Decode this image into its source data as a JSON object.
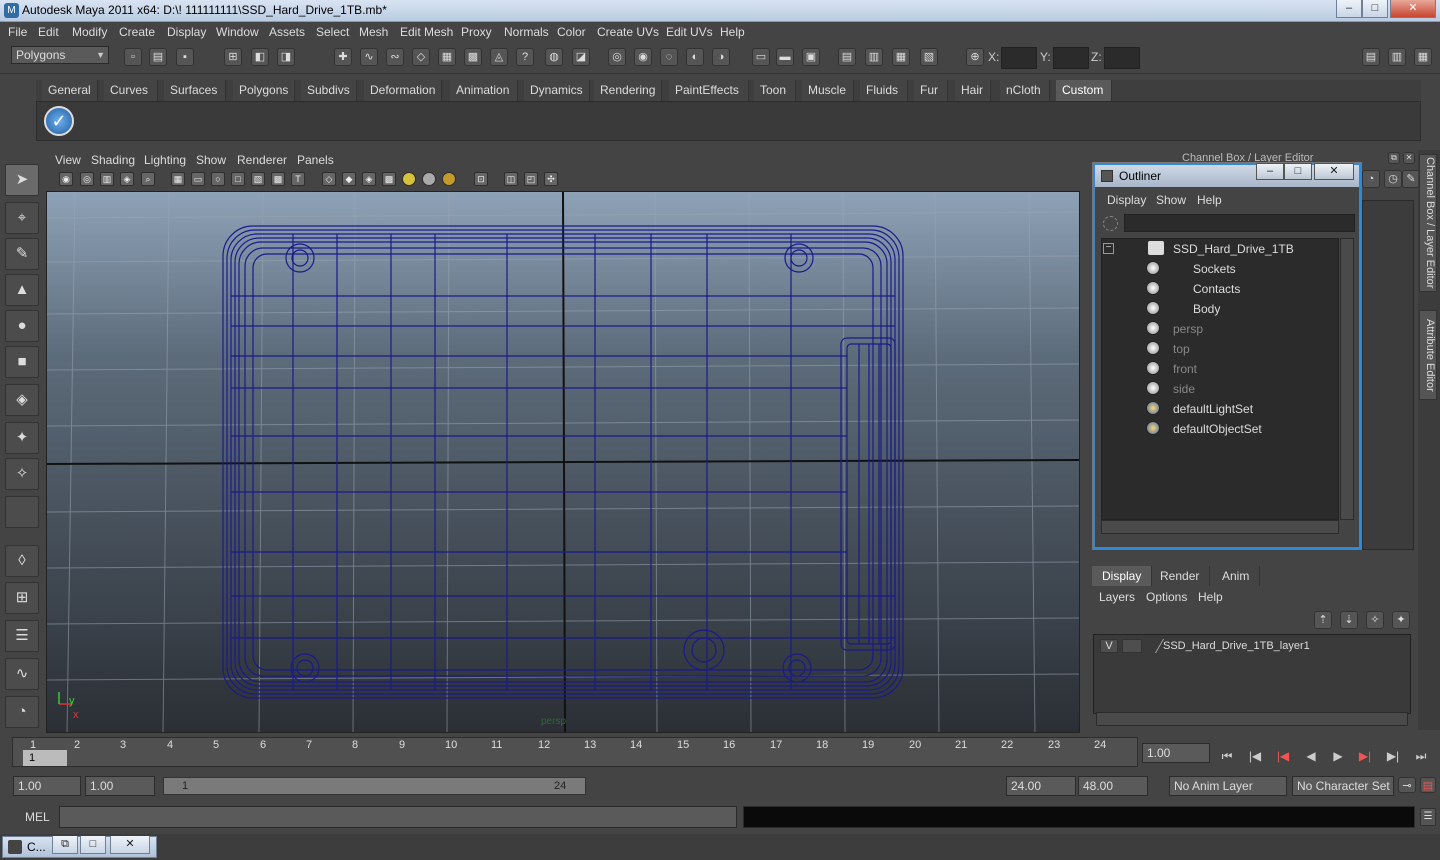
{
  "window": {
    "title": "Autodesk Maya 2011 x64: D:\\! 111111111\\SSD_Hard_Drive_1TB.mb*",
    "min": "–",
    "max": "□",
    "close": "✕"
  },
  "menubar": [
    "File",
    "Edit",
    "Modify",
    "Create",
    "Display",
    "Window",
    "Assets",
    "Select",
    "Mesh",
    "Edit Mesh",
    "Proxy",
    "Normals",
    "Color",
    "Create UVs",
    "Edit UVs",
    "Help"
  ],
  "status": {
    "mode": "Polygons",
    "x_label": "X:",
    "y_label": "Y:",
    "z_label": "Z:"
  },
  "shelf_tabs": [
    "General",
    "Curves",
    "Surfaces",
    "Polygons",
    "Subdivs",
    "Deformation",
    "Animation",
    "Dynamics",
    "Rendering",
    "PaintEffects",
    "Toon",
    "Muscle",
    "Fluids",
    "Fur",
    "Hair",
    "nCloth",
    "Custom"
  ],
  "shelf_active": "Custom",
  "viewport": {
    "menu": [
      "View",
      "Shading",
      "Lighting",
      "Show",
      "Renderer",
      "Panels"
    ],
    "camera": "persp",
    "axis_x": "x",
    "axis_y": "y"
  },
  "channel_box_title": "Channel Box / Layer Editor",
  "side_tabs": [
    "Channel Box / Layer Editor",
    "Attribute Editor"
  ],
  "outliner": {
    "title": "Outliner",
    "menu": [
      "Display",
      "Show",
      "Help"
    ],
    "items": [
      {
        "label": "SSD_Hard_Drive_1TB",
        "dim": false
      },
      {
        "label": "Sockets",
        "dim": false
      },
      {
        "label": "Contacts",
        "dim": false
      },
      {
        "label": "Body",
        "dim": false
      },
      {
        "label": "persp",
        "dim": true
      },
      {
        "label": "top",
        "dim": true
      },
      {
        "label": "front",
        "dim": true
      },
      {
        "label": "side",
        "dim": true
      },
      {
        "label": "defaultLightSet",
        "dim": false
      },
      {
        "label": "defaultObjectSet",
        "dim": false
      }
    ]
  },
  "layer_editor": {
    "tabs": [
      "Display",
      "Render",
      "Anim"
    ],
    "menu": [
      "Layers",
      "Options",
      "Help"
    ],
    "layer": {
      "visible": "V",
      "name": "SSD_Hard_Drive_1TB_layer1"
    }
  },
  "timeline": {
    "ticks": [
      "1",
      "2",
      "3",
      "4",
      "5",
      "6",
      "7",
      "8",
      "9",
      "10",
      "11",
      "12",
      "13",
      "14",
      "15",
      "16",
      "17",
      "18",
      "19",
      "20",
      "21",
      "22",
      "23",
      "24"
    ],
    "current_frame": "1",
    "current_field": "1.00"
  },
  "range": {
    "start": "1.00",
    "current_start": "1.00",
    "slider_left": "1",
    "slider_right": "24",
    "end": "24.00",
    "total_end": "48.00",
    "anim_layer": "No Anim Layer",
    "character_set": "No Character Set"
  },
  "command": {
    "label": "MEL"
  },
  "taskbar": {
    "item": "C..."
  }
}
